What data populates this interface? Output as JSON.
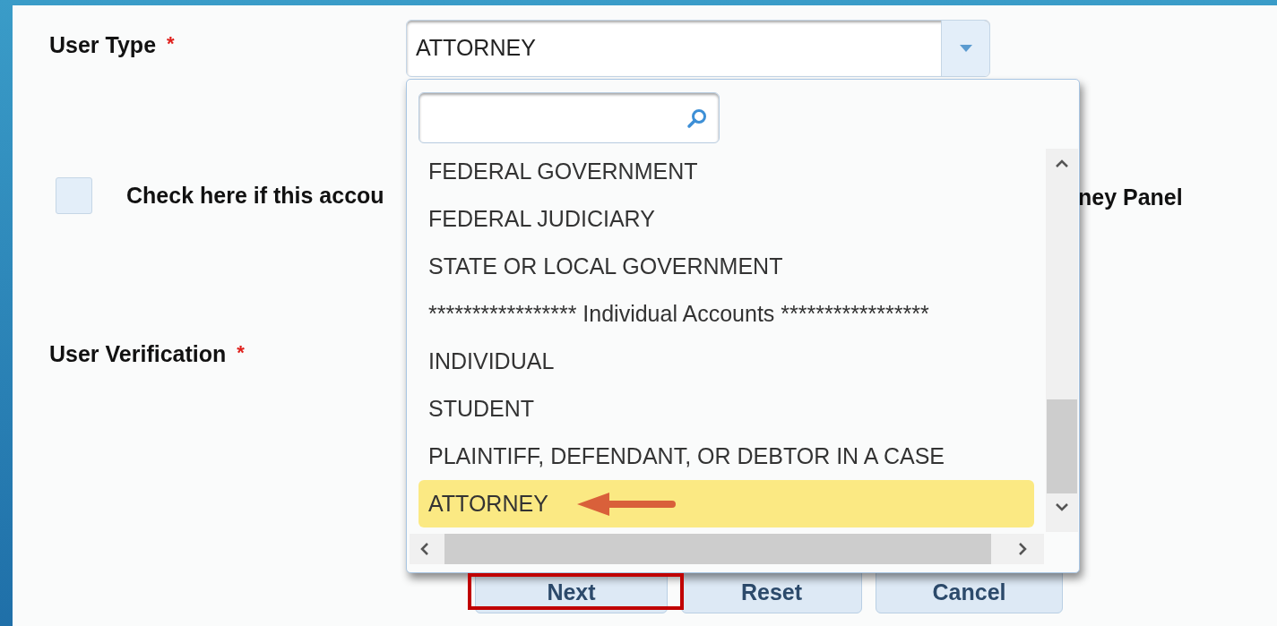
{
  "user_type": {
    "label": "User Type",
    "required_mark": "*",
    "value": "ATTORNEY"
  },
  "dropdown": {
    "items": [
      {
        "label": "FEDERAL GOVERNMENT",
        "selected": false
      },
      {
        "label": "FEDERAL JUDICIARY",
        "selected": false
      },
      {
        "label": "STATE OR LOCAL GOVERNMENT",
        "selected": false
      },
      {
        "label": "***************** Individual Accounts *****************",
        "selected": false
      },
      {
        "label": "INDIVIDUAL",
        "selected": false
      },
      {
        "label": "STUDENT",
        "selected": false
      },
      {
        "label": "PLAINTIFF, DEFENDANT, OR DEBTOR IN A CASE",
        "selected": false
      },
      {
        "label": "ATTORNEY",
        "selected": true
      }
    ]
  },
  "checkbox": {
    "checked": false,
    "label_start": "Check here if this accou",
    "label_end": "ney Panel"
  },
  "user_verification": {
    "label": "User Verification",
    "required_mark": "*"
  },
  "buttons": [
    {
      "label": "Next",
      "highlighted": true
    },
    {
      "label": "Reset",
      "highlighted": false
    },
    {
      "label": "Cancel",
      "highlighted": false
    }
  ],
  "annotations": {
    "arrow_on_selected": true
  }
}
